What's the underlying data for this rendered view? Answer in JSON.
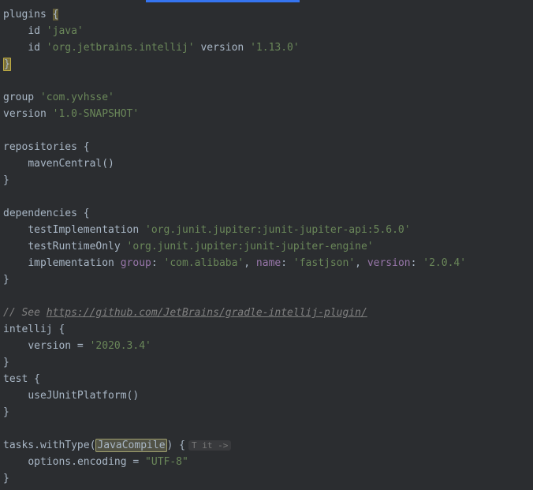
{
  "plugins": {
    "keyword": "plugins",
    "id_kw": "id",
    "java": "'java'",
    "intellij_id": "'org.jetbrains.intellij'",
    "version_kw": "version",
    "intellij_version": "'1.13.0'"
  },
  "project": {
    "group_kw": "group",
    "group_val": "'com.yvhsse'",
    "version_kw": "version",
    "version_val": "'1.0-SNAPSHOT'"
  },
  "repositories": {
    "keyword": "repositories",
    "maven": "mavenCentral()"
  },
  "dependencies": {
    "keyword": "dependencies",
    "testImpl_kw": "testImplementation",
    "testImpl_val": "'org.junit.jupiter:junit-jupiter-api:5.6.0'",
    "testRt_kw": "testRuntimeOnly",
    "testRt_val": "'org.junit.jupiter:junit-jupiter-engine'",
    "impl_kw": "implementation",
    "impl_group_kw": "group",
    "impl_group_val": "'com.alibaba'",
    "impl_name_kw": "name",
    "impl_name_val": "'fastjson'",
    "impl_version_kw": "version",
    "impl_version_val": "'2.0.4'"
  },
  "comment": {
    "see": "// See ",
    "url": "https://github.com/JetBrains/gradle-intellij-plugin/"
  },
  "intellij": {
    "keyword": "intellij",
    "version_kw": "version",
    "eq": " = ",
    "version_val": "'2020.3.4'"
  },
  "test": {
    "keyword": "test",
    "junit": "useJUnitPlatform()"
  },
  "tasks": {
    "tasks_kw": "tasks",
    "withType_kw": "withType",
    "javaCompile": "JavaCompile",
    "inlay": "T it ->",
    "options_kw": "options",
    "encoding_kw": "encoding",
    "eq": " = ",
    "encoding_val": "\"UTF-8\""
  },
  "braces": {
    "open": "{",
    "close": "}",
    "paren_open": "(",
    "paren_close": ")",
    "colon": ":",
    "comma": ",",
    "dot": "."
  }
}
